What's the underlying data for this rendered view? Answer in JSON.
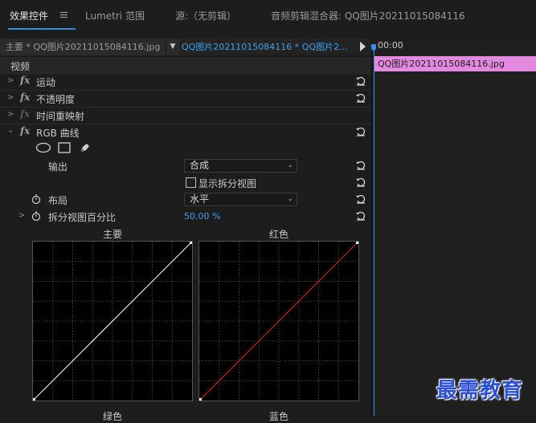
{
  "tabs": [
    {
      "label": "效果控件",
      "active": true
    },
    {
      "label": "Lumetri 范围",
      "active": false
    },
    {
      "label": "源:（无剪辑）",
      "active": false
    },
    {
      "label": "音频剪辑混合器: QQ图片20211015084116",
      "active": false
    }
  ],
  "source": {
    "master": "主要 * QQ图片20211015084116.jpg",
    "sequence": "QQ图片20211015084116 * QQ图片2..."
  },
  "timeline": {
    "time": "00:00",
    "clip": "QQ图片20211015084116.jpg"
  },
  "section_header": "视频",
  "effects": [
    {
      "name": "运动",
      "enabled": true
    },
    {
      "name": "不透明度",
      "enabled": true
    },
    {
      "name": "时间重映射",
      "enabled": false
    },
    {
      "name": "RGB 曲线",
      "enabled": true
    }
  ],
  "rgb_curves": {
    "output_label": "输出",
    "output_value": "合成",
    "split_view_label": "显示拆分视图",
    "split_view_checked": false,
    "layout_label": "布局",
    "layout_value": "水平",
    "split_percent_label": "拆分视图百分比",
    "split_percent_value": "50.00 %"
  },
  "curves": [
    {
      "label": "主要",
      "color": "#e8e8e8"
    },
    {
      "label": "红色",
      "color": "#c0201c"
    },
    {
      "label": "绿色",
      "color": "#2ca02c"
    },
    {
      "label": "蓝色",
      "color": "#2050d0"
    }
  ],
  "watermark": "最需教育",
  "colors": {
    "accent": "#3a8dde",
    "clip": "#e38ae0",
    "value_link": "#3aa0f0"
  }
}
